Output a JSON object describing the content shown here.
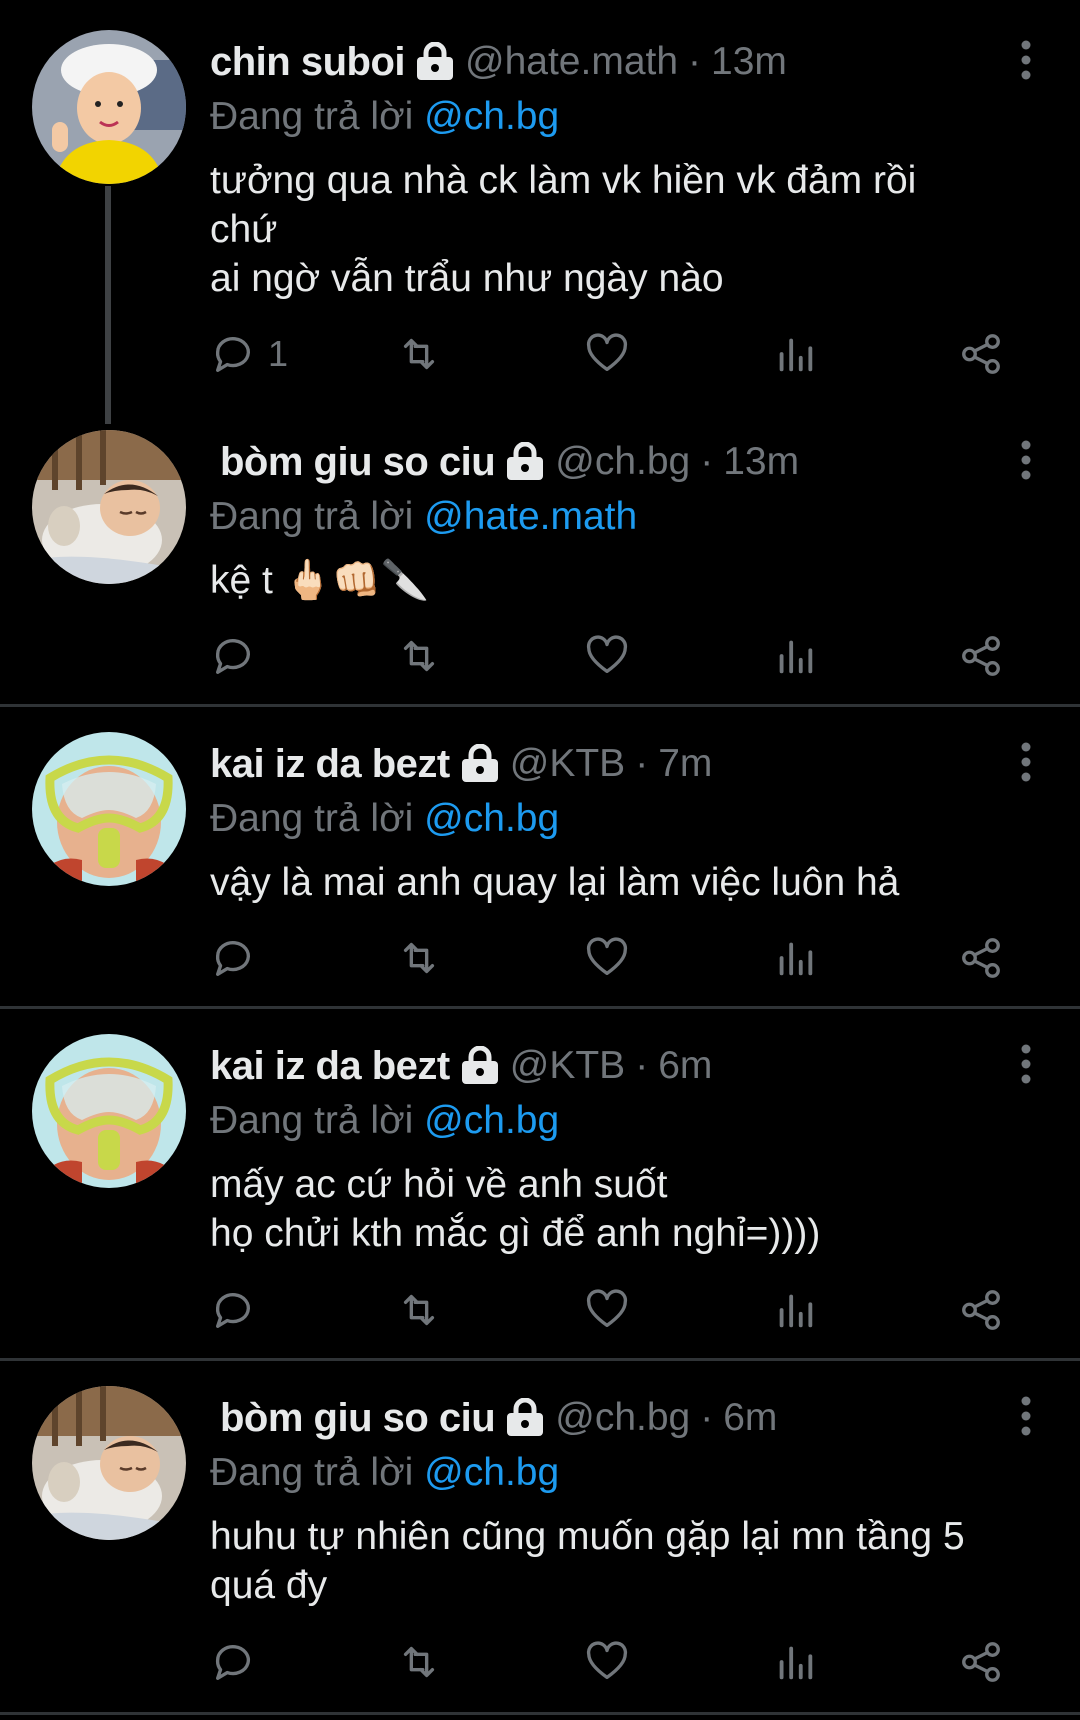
{
  "tweets": [
    {
      "name": "chin suboi",
      "handle": "@hate.math",
      "time": "13m",
      "reply_prefix": "Đang trả lời",
      "reply_to": "@ch.bg",
      "text": "tưởng qua nhà ck làm vk hiền vk đảm rồi\nchứ\nai ngờ vẫn trẩu như ngày nào",
      "reply_count": "1",
      "avatar": "child-yellow-shirt-white-hat"
    },
    {
      "name": "bòm giu so ciu",
      "handle": "@ch.bg",
      "time": "13m",
      "reply_prefix": "Đang trả lời",
      "reply_to": "@hate.math",
      "text": "kệ t 🖕🏻👊🏻🔪",
      "reply_count": "",
      "avatar": "sleeping-child"
    },
    {
      "name": "kai iz da bezt",
      "handle": "@KTB",
      "time": "7m",
      "reply_prefix": "Đang trả lời",
      "reply_to": "@ch.bg",
      "text": "vậy là mai anh quay lại làm việc luôn hả",
      "reply_count": "",
      "avatar": "child-snorkel-goggles"
    },
    {
      "name": "kai iz da bezt",
      "handle": "@KTB",
      "time": "6m",
      "reply_prefix": "Đang trả lời",
      "reply_to": "@ch.bg",
      "text": "mấy ac cứ hỏi về anh suốt\nhọ chửi kth mắc gì để anh nghỉ=))))",
      "reply_count": "",
      "avatar": "child-snorkel-goggles"
    },
    {
      "name": "bòm giu so ciu",
      "handle": "@ch.bg",
      "time": "6m",
      "reply_prefix": "Đang trả lời",
      "reply_to": "@ch.bg",
      "text": "huhu tự nhiên cũng muốn gặp lại mn tầng 5\nquá đy",
      "reply_count": "",
      "avatar": "sleeping-child"
    }
  ],
  "icons": {
    "lock": "lock-icon",
    "more": "more-vertical-icon",
    "reply": "reply-icon",
    "retweet": "retweet-icon",
    "like": "heart-icon",
    "views": "views-icon",
    "share": "share-icon"
  },
  "colors": {
    "background": "#000000",
    "text": "#e7e9ea",
    "muted": "#71767b",
    "mention": "#1d9bf0",
    "divider": "#2f3336"
  }
}
